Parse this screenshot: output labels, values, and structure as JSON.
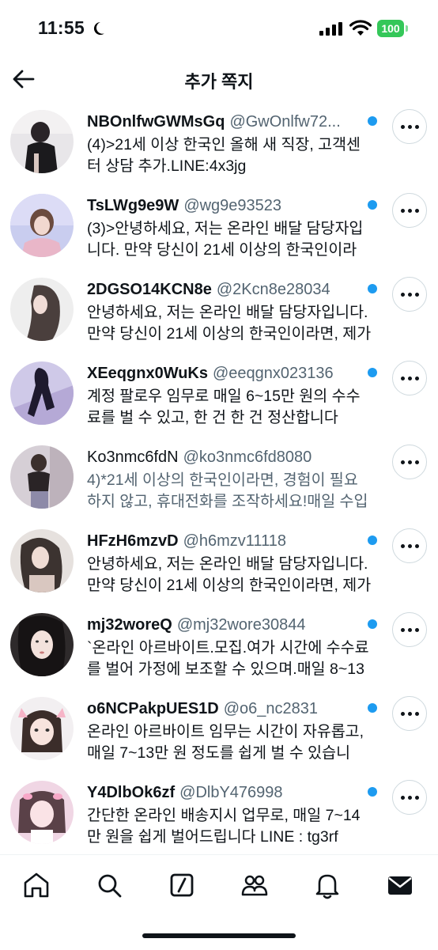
{
  "status_bar": {
    "time": "11:55",
    "battery": "100"
  },
  "header": {
    "title": "추가 쪽지"
  },
  "messages": [
    {
      "name": "NBOnlfwGWMsGq",
      "handle": "@GwOnlfw72...",
      "text": "(4)>21세 이상 한국인 올해 새 직장, 고객센터 상담 추가.LINE:4x3jg",
      "unread": true
    },
    {
      "name": "TsLWg9e9W",
      "handle": "@wg9e93523",
      "text": "(3)>안녕하세요, 저는 온라인 배달 담당자입니다. 만약 당신이 21세 이상의 한국인이라",
      "unread": true
    },
    {
      "name": "2DGSO14KCN8e",
      "handle": "@2Kcn8e28034",
      "text": "안녕하세요, 저는 온라인 배달 담당자입니다. 만약 당신이 21세 이상의 한국인이라면, 제가",
      "unread": true
    },
    {
      "name": "XEeqgnx0WuKs",
      "handle": "@eeqgnx023136",
      "text": "계정 팔로우 임무로 매일 6~15만 원의 수수료를 벌 수 있고, 한 건 한 건 정산합니다",
      "unread": true
    },
    {
      "name": "Ko3nmc6fdN",
      "handle": "@ko3nmc6fd8080",
      "text": "4)*21세 이상의 한국인이라면, 경험이 필요하지 않고, 휴대전화를 조작하세요!매일 수입",
      "unread": false
    },
    {
      "name": "HFzH6mzvD",
      "handle": "@h6mzv11118",
      "text": "안녕하세요, 저는 온라인 배달 담당자입니다. 만약 당신이 21세 이상의 한국인이라면, 제가",
      "unread": true
    },
    {
      "name": "mj32woreQ",
      "handle": "@mj32wore30844",
      "text": "`온라인 아르바이트.모집.여가 시간에 수수료를 벌어 가정에 보조할 수 있으며.매일 8~13",
      "unread": true
    },
    {
      "name": "o6NCPakpUES1D",
      "handle": "@o6_nc2831",
      "text": "온라인 아르바이트 임무는 시간이 자유롭고, 매일 7~13만 원 정도를 쉽게 벌 수 있습니",
      "unread": true
    },
    {
      "name": "Y4DlbOk6zf",
      "handle": "@DlbY476998",
      "text": "간단한 온라인 배송지시 업무로, 매일 7~14만 원을 쉽게 벌어드립니다 LINE : tg3rf",
      "unread": true
    }
  ],
  "tabs": [
    {
      "icon": "home-icon"
    },
    {
      "icon": "search-icon"
    },
    {
      "icon": "grok-icon"
    },
    {
      "icon": "communities-icon"
    },
    {
      "icon": "notifications-icon"
    },
    {
      "icon": "messages-icon"
    }
  ],
  "colors": {
    "accent": "#1d9bf0",
    "battery": "#34c759",
    "secondary_text": "#536471"
  }
}
